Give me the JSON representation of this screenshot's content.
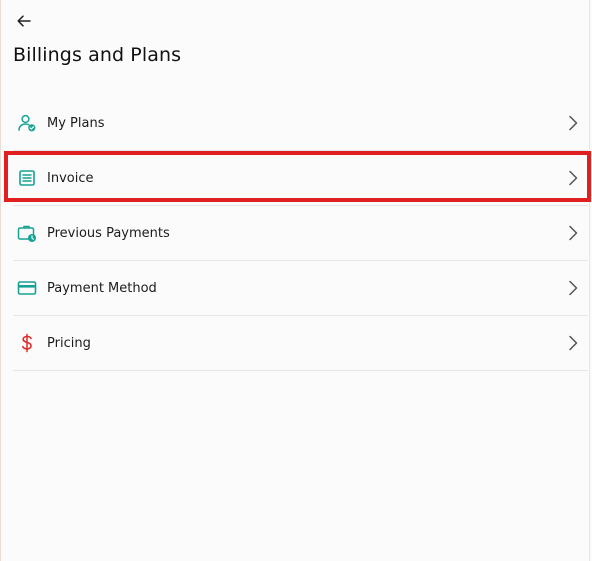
{
  "page": {
    "title": "Billings and Plans"
  },
  "menu": [
    {
      "label": "My Plans",
      "icon": "user-check-icon"
    },
    {
      "label": "Invoice",
      "icon": "invoice-icon"
    },
    {
      "label": "Previous Payments",
      "icon": "briefcase-clock-icon"
    },
    {
      "label": "Payment Method",
      "icon": "credit-card-icon"
    },
    {
      "label": "Pricing",
      "icon": "dollar-icon"
    }
  ],
  "colors": {
    "accent": "#16a394",
    "pricing_icon": "#e02b2b",
    "highlight": "#e02020"
  }
}
